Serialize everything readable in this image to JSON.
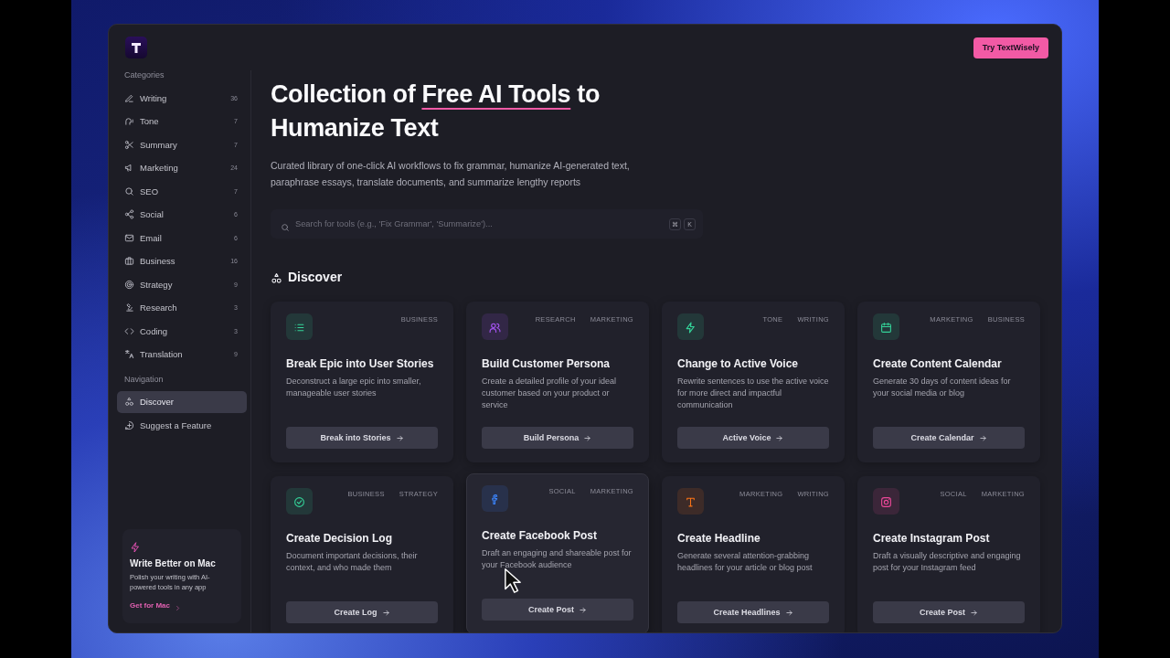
{
  "brand": {
    "button": "Try TextWisely"
  },
  "sidebar": {
    "categories_label": "Categories",
    "categories": [
      {
        "label": "Writing",
        "count": "36"
      },
      {
        "label": "Tone",
        "count": "7"
      },
      {
        "label": "Summary",
        "count": "7"
      },
      {
        "label": "Marketing",
        "count": "24"
      },
      {
        "label": "SEO",
        "count": "7"
      },
      {
        "label": "Social",
        "count": "6"
      },
      {
        "label": "Email",
        "count": "6"
      },
      {
        "label": "Business",
        "count": "16"
      },
      {
        "label": "Strategy",
        "count": "9"
      },
      {
        "label": "Research",
        "count": "3"
      },
      {
        "label": "Coding",
        "count": "3"
      },
      {
        "label": "Translation",
        "count": "9"
      }
    ],
    "navigation_label": "Navigation",
    "navigation": [
      {
        "label": "Discover",
        "selected": true
      },
      {
        "label": "Suggest a Feature",
        "selected": false
      }
    ],
    "promo": {
      "title": "Write Better on Mac",
      "text": "Polish your writing with AI-powered tools in any app",
      "link": "Get for Mac"
    }
  },
  "hero": {
    "title_before": "Collection of ",
    "title_highlight": "Free AI Tools",
    "title_after": " to Humanize Text",
    "subtitle": "Curated library of one-click AI workflows to fix grammar, humanize AI-generated text, paraphrase essays, translate documents, and summarize lengthy reports"
  },
  "search": {
    "placeholder": "Search for tools (e.g., 'Fix Grammar', 'Summarize')...",
    "keys": [
      "⌘",
      "K"
    ]
  },
  "section_title": "Discover",
  "cards": [
    {
      "title": "Break Epic into User Stories",
      "description": "Deconstruct a large epic into smaller, manageable user stories",
      "tags": [
        "BUSINESS"
      ],
      "button": "Break into Stories",
      "color": "#34d399",
      "hovered": false
    },
    {
      "title": "Build Customer Persona",
      "description": "Create a detailed profile of your ideal customer based on your product or service",
      "tags": [
        "RESEARCH",
        "MARKETING"
      ],
      "button": "Build Persona",
      "color": "#a855f7",
      "hovered": false
    },
    {
      "title": "Change to Active Voice",
      "description": "Rewrite sentences to use the active voice for more direct and impactful communication",
      "tags": [
        "TONE",
        "WRITING"
      ],
      "button": "Active Voice",
      "color": "#34d399",
      "hovered": false
    },
    {
      "title": "Create Content Calendar",
      "description": "Generate 30 days of content ideas for your social media or blog",
      "tags": [
        "MARKETING",
        "BUSINESS"
      ],
      "button": "Create Calendar",
      "color": "#34d399",
      "hovered": false
    },
    {
      "title": "Create Decision Log",
      "description": "Document important decisions, their context, and who made them",
      "tags": [
        "BUSINESS",
        "STRATEGY"
      ],
      "button": "Create Log",
      "color": "#34d399",
      "hovered": false
    },
    {
      "title": "Create Facebook Post",
      "description": "Draft an engaging and shareable post for your Facebook audience",
      "tags": [
        "SOCIAL",
        "MARKETING"
      ],
      "button": "Create Post",
      "color": "#3b82f6",
      "hovered": true
    },
    {
      "title": "Create Headline",
      "description": "Generate several attention-grabbing headlines for your article or blog post",
      "tags": [
        "MARKETING",
        "WRITING"
      ],
      "button": "Create Headlines",
      "color": "#f97316",
      "hovered": false
    },
    {
      "title": "Create Instagram Post",
      "description": "Draft a visually descriptive and engaging post for your Instagram feed",
      "tags": [
        "SOCIAL",
        "MARKETING"
      ],
      "button": "Create Post",
      "color": "#ec4899",
      "hovered": false
    }
  ]
}
